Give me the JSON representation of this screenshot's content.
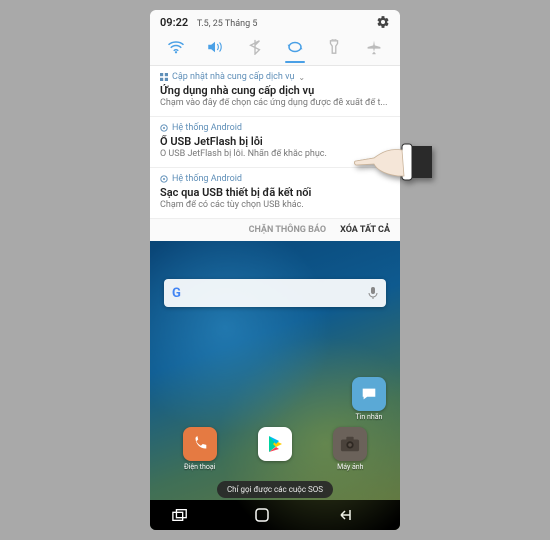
{
  "status": {
    "time": "09:22",
    "date": "T.5, 25 Tháng 5"
  },
  "quicksettings": {
    "wifi": "wifi-icon",
    "sound": "sound-icon",
    "bluetooth": "bluetooth-icon",
    "sync": "sync-icon",
    "flashlight": "flashlight-icon",
    "airplane": "airplane-icon"
  },
  "notifications": [
    {
      "app": "Cập nhật nhà cung cấp dịch vụ",
      "title": "Ứng dụng nhà cung cấp dịch vụ",
      "body": "Chạm vào đây để chọn các ứng dụng được đề xuất để t..."
    },
    {
      "app": "Hệ thống Android",
      "title": "Ổ USB JetFlash bị lỗi",
      "body": "Ổ USB JetFlash bị lỗi. Nhấn để khắc phục."
    },
    {
      "app": "Hệ thống Android",
      "title": "Sạc qua USB thiết bị đã kết nối",
      "body": "Chạm để có các tùy chọn USB khác."
    }
  ],
  "actions": {
    "block": "CHẶN THÔNG BÁO",
    "clear": "XÓA TẤT CẢ"
  },
  "homescreen": {
    "apps": {
      "messages": "Tin nhắn",
      "phone": "Điện thoại",
      "camera": "Máy ảnh"
    },
    "sos_toast": "Chỉ gọi được các cuộc SOS"
  }
}
